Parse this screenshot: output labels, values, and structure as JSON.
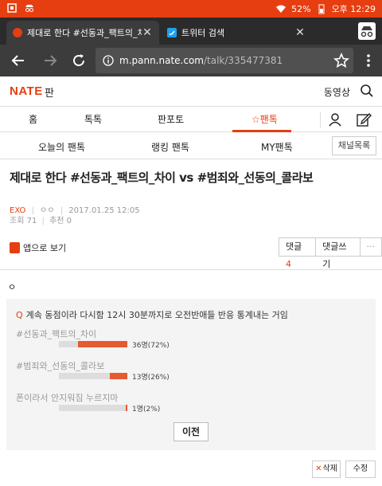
{
  "status_bar": {
    "battery": "52%",
    "time": "오후 12:29"
  },
  "browser": {
    "tabs": [
      {
        "title": "제대로 한다 #선동과_팩트의_차이 vs",
        "active": true
      },
      {
        "title": "트위터 검색",
        "active": false
      }
    ],
    "url_host": "m.pann.nate.com",
    "url_path": "/talk/335477381"
  },
  "nate": {
    "logo": "NATE",
    "logo_sub": "판",
    "video_link": "동영상"
  },
  "main_nav": {
    "items": [
      "홈",
      "톡톡",
      "판포토",
      "☆팬톡"
    ],
    "selected_index": 3
  },
  "sub_nav": {
    "items": [
      "오늘의 팬톡",
      "랭킹 팬톡",
      "MY팬톡"
    ],
    "channel_button": "채널목록"
  },
  "article": {
    "title": "제대로 한다 #선동과_팩트의_차이 vs #범죄와_선동의_콜라보",
    "author": "EXO",
    "author_id": "ㅇㅇ",
    "date": "2017.01.25 12:05",
    "views_label": "조회 71",
    "recommend_label": "추천 0",
    "app_button": "앱으로 보기",
    "comments_label": "댓글",
    "comments_count": "4",
    "write_comment": "댓글쓰기",
    "more": "···",
    "body": "ㅇ"
  },
  "poll": {
    "question_mark": "Q",
    "question": "계속 동점이라 다시함 12시 30분까지로 오전반애들 반응 통계내는 거임",
    "options": [
      {
        "label": "#선동과_팩트의_차이",
        "result": "36명(72%)",
        "percent": 72
      },
      {
        "label": "#범죄와_선동의_콜라보",
        "result": "13명(26%)",
        "percent": 26
      },
      {
        "label": "폰이라서 안지워짐 누르지마",
        "result": "1명(2%)",
        "percent": 2
      }
    ],
    "prev_button": "이전"
  },
  "actions": {
    "delete": "삭제",
    "delete_mark": "✕",
    "edit": "수정"
  },
  "colors": {
    "accent": "#e63e11",
    "status_bar": "#e63e11",
    "bar_fill": "#e65a2f"
  }
}
